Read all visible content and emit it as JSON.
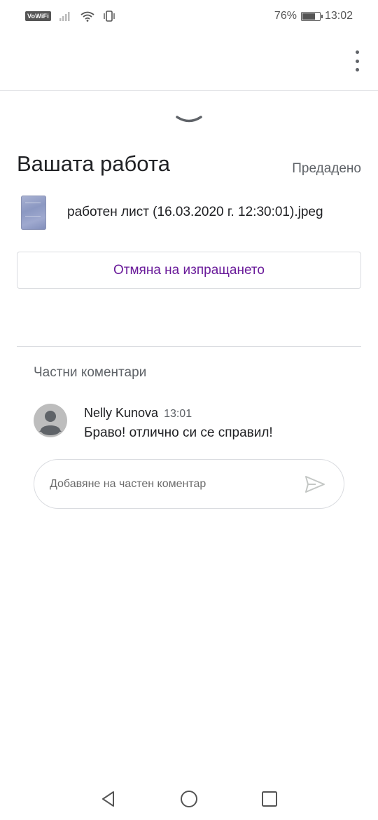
{
  "status_bar": {
    "vowifi_label": "VoWiFi",
    "battery_percent_text": "76%",
    "battery_level": 0.76,
    "time": "13:02"
  },
  "your_work": {
    "title": "Вашата работа",
    "status": "Предадено",
    "attachment_name": "работен лист (16.03.2020 г. 12:30:01).jpeg",
    "unsubmit_label": "Отмяна на изпращането"
  },
  "private_comments": {
    "heading": "Частни коментари",
    "comments": [
      {
        "author": "Nelly Kunova",
        "time": "13:01",
        "text": "Браво! отлично си се справил!"
      }
    ],
    "input_placeholder": "Добавяне на частен коментар",
    "input_value": ""
  },
  "colors": {
    "accent_purple": "#6a1b9a",
    "divider": "#dadce0",
    "secondary_text": "#5f6368"
  },
  "icons": {
    "overflow": "more-vert-icon",
    "handle": "chevron-down-icon",
    "avatar": "person-avatar-icon",
    "send": "send-icon",
    "nav_back": "triangle-back-icon",
    "nav_home": "circle-home-icon",
    "nav_recents": "square-recents-icon"
  }
}
